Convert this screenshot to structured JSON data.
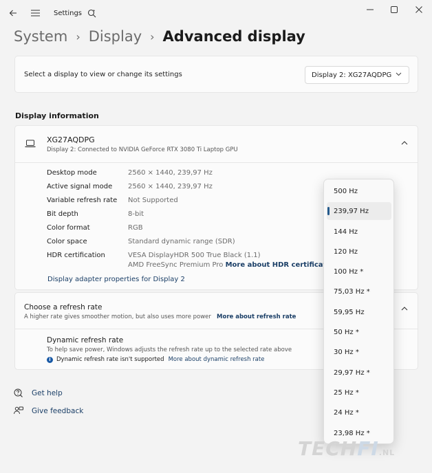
{
  "window": {
    "title": "Settings",
    "colors": {
      "accent": "#245a8c",
      "link": "#1b3f67",
      "background": "#f3f3f3",
      "card": "#fbfbfb"
    }
  },
  "breadcrumb": {
    "items": [
      "System",
      "Display"
    ],
    "current": "Advanced display"
  },
  "display_select": {
    "label": "Select a display to view or change its settings",
    "value": "Display 2: XG27AQDPG"
  },
  "display_info": {
    "section_title": "Display information",
    "name": "XG27AQDPG",
    "subtitle": "Display 2: Connected to NVIDIA GeForce RTX 3080 Ti Laptop GPU",
    "rows": [
      {
        "key": "Desktop mode",
        "value": "2560 × 1440, 239,97 Hz"
      },
      {
        "key": "Active signal mode",
        "value": "2560 × 1440, 239,97 Hz"
      },
      {
        "key": "Variable refresh rate",
        "value": "Not Supported"
      },
      {
        "key": "Bit depth",
        "value": "8-bit"
      },
      {
        "key": "Color format",
        "value": "RGB"
      },
      {
        "key": "Color space",
        "value": "Standard dynamic range (SDR)"
      },
      {
        "key": "HDR certification",
        "value": "VESA DisplayHDR 500 True Black (1.1)"
      }
    ],
    "hdr_line2": "AMD FreeSync Premium Pro",
    "hdr_link": "More about HDR certification",
    "adapter_link": "Display adapter properties for Display 2"
  },
  "refresh": {
    "title": "Choose a refresh rate",
    "subtitle": "A higher rate gives smoother motion, but also uses more power",
    "subtitle_link": "More about refresh rate",
    "dynamic_title": "Dynamic refresh rate",
    "dynamic_sub": "To help save power, Windows adjusts the refresh rate up to the selected rate above",
    "dynamic_note": "Dynamic refresh rate isn't supported",
    "dynamic_link": "More about dynamic refresh rate"
  },
  "help": {
    "get_help": "Get help",
    "give_feedback": "Give feedback"
  },
  "refresh_options": {
    "selected": "239,97 Hz",
    "items": [
      "500 Hz",
      "239,97 Hz",
      "144 Hz",
      "120 Hz",
      "100 Hz *",
      "75,03 Hz *",
      "59,95 Hz",
      "50 Hz *",
      "30 Hz *",
      "29,97 Hz *",
      "25 Hz *",
      "24 Hz *",
      "23,98 Hz *"
    ]
  },
  "watermark": {
    "part1": "TECH",
    "part2": "FI",
    "part3": ".NL"
  }
}
